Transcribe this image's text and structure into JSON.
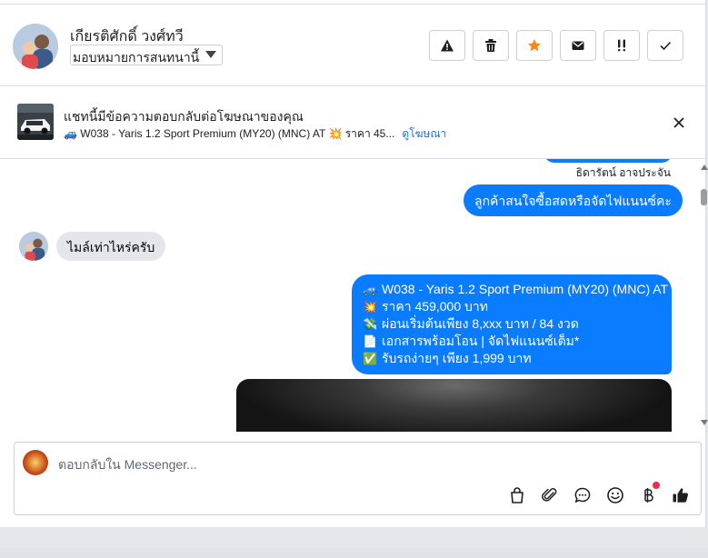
{
  "header": {
    "contact_name": "เกียรติศักดิ์ วงศ์ทวี",
    "assign_label": "มอบหมายการสนทนานี้",
    "toolbar": [
      {
        "name": "spam-button",
        "icon": "warning-icon"
      },
      {
        "name": "delete-button",
        "icon": "trash-icon"
      },
      {
        "name": "star-button",
        "icon": "star-icon"
      },
      {
        "name": "mark-unread-button",
        "icon": "envelope-icon"
      },
      {
        "name": "follow-up-button",
        "icon": "double-exclamation-icon"
      },
      {
        "name": "mark-done-button",
        "icon": "check-icon"
      }
    ],
    "star_color": "#f5851f"
  },
  "ad_banner": {
    "title": "แชทนี้มีข้อความตอบกลับต่อโฆษณาของคุณ",
    "subtitle": "🚙 W038 - Yaris 1.2 Sport Premium (MY20) (MNC) AT 💥 ราคา 45...",
    "link": "ดูโฆษณา"
  },
  "conversation": {
    "sender_name": "ธิดารัตน์ อาจประจัน",
    "message_out_1": "ลูกค้าสนใจซื้อสดหรือจัดไฟแนนซ์คะ",
    "message_in_1": "ไมล์เท่าไหร่ครับ",
    "message_out_2": [
      {
        "emoji": "🚙",
        "text": "W038 - Yaris 1.2 Sport Premium (MY20) (MNC) AT"
      },
      {
        "emoji": "💥",
        "text": "ราคา 459,000 บาท"
      },
      {
        "emoji": "💸",
        "text": "ผ่อนเริ่มต้นเพียง 8,xxx บาท / 84 งวด"
      },
      {
        "emoji": "📄",
        "text": "เอกสารพร้อมโอน | จัดไฟแนนซ์เต็ม*"
      },
      {
        "emoji": "✅",
        "text": "รับรถง่ายๆ เพียง 1,999 บาท"
      }
    ],
    "bubble_color": "#0a7cff"
  },
  "composer": {
    "placeholder": "ตอบกลับใน Messenger...",
    "icons": [
      "shopping-bag-icon",
      "paperclip-icon",
      "saved-replies-icon",
      "emoji-icon",
      "baht-payment-icon",
      "thumbs-up-icon"
    ]
  }
}
